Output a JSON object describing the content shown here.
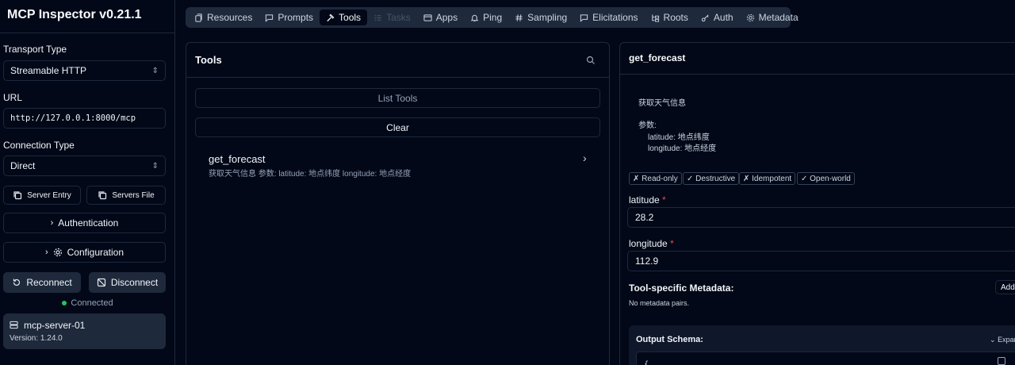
{
  "app": {
    "title": "MCP Inspector v0.21.1"
  },
  "sidebar": {
    "transport_label": "Transport Type",
    "transport_value": "Streamable HTTP",
    "url_label": "URL",
    "url_value": "http://127.0.0.1:8000/mcp",
    "connection_label": "Connection Type",
    "connection_value": "Direct",
    "server_entry_label": "Server Entry",
    "servers_file_label": "Servers File",
    "authentication_label": "Authentication",
    "configuration_label": "Configuration",
    "reconnect_label": "Reconnect",
    "disconnect_label": "Disconnect",
    "status_text": "Connected",
    "status_color": "#22c55e",
    "server_name": "mcp-server-01",
    "server_version": "Version: 1.24.0"
  },
  "tabs": [
    {
      "label": "Resources",
      "icon": "file-icon"
    },
    {
      "label": "Prompts",
      "icon": "message-icon"
    },
    {
      "label": "Tools",
      "icon": "hammer-icon",
      "active": true
    },
    {
      "label": "Tasks",
      "icon": "list-icon",
      "disabled": true
    },
    {
      "label": "Apps",
      "icon": "app-window-icon"
    },
    {
      "label": "Ping",
      "icon": "bell-icon"
    },
    {
      "label": "Sampling",
      "icon": "hash-icon"
    },
    {
      "label": "Elicitations",
      "icon": "message-square-icon"
    },
    {
      "label": "Roots",
      "icon": "folder-tree-icon"
    },
    {
      "label": "Auth",
      "icon": "key-icon"
    },
    {
      "label": "Metadata",
      "icon": "gear-icon"
    }
  ],
  "tools_panel": {
    "title": "Tools",
    "list_tools_label": "List Tools",
    "clear_label": "Clear",
    "tools": [
      {
        "name": "get_forecast",
        "description": "获取天气信息 参数: latitude: 地点纬度 longitude: 地点经度"
      }
    ]
  },
  "detail": {
    "tool_name": "get_forecast",
    "description_line1": "获取天气信息",
    "params_heading": "参数:",
    "param1": "latitude: 地点纬度",
    "param2": "longitude: 地点经度",
    "badges": [
      "✗ Read-only",
      "✓ Destructive",
      "✗ Idempotent",
      "✓ Open-world"
    ],
    "latitude_label": "latitude",
    "latitude_value": "28.2",
    "longitude_label": "longitude",
    "longitude_value": "112.9",
    "required_mark": "*",
    "metadata_heading": "Tool-specific Metadata:",
    "metadata_add_label": "Add",
    "metadata_empty": "No metadata pairs.",
    "output_schema_heading": "Output Schema:",
    "expand_label": "Expand",
    "schema_open_char": "{"
  }
}
